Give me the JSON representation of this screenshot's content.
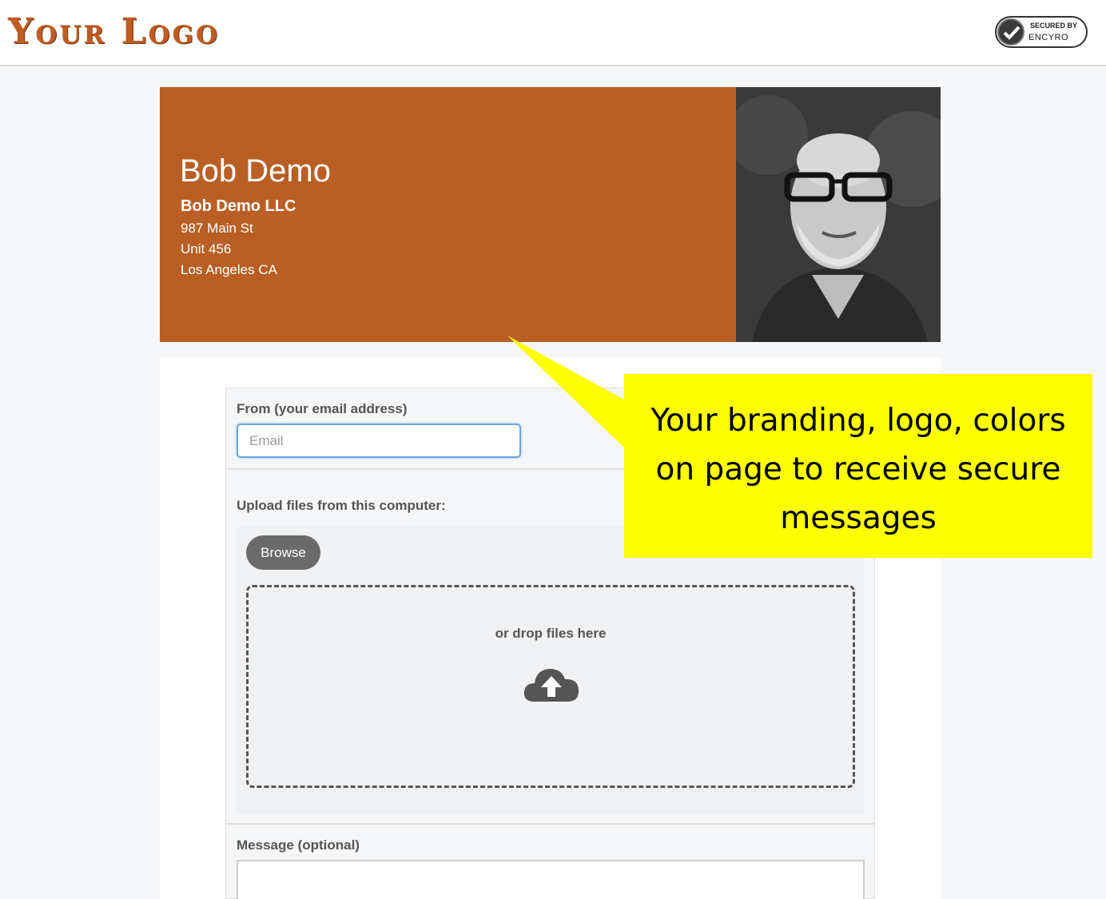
{
  "header": {
    "logo_text": "Your Logo",
    "badge_top": "SECURED BY",
    "badge_bottom": "ENCYRO"
  },
  "profile": {
    "name": "Bob Demo",
    "company": "Bob Demo LLC",
    "address_lines": [
      "987 Main St",
      "Unit 456",
      "Los Angeles CA"
    ],
    "brand_color": "#b95f25"
  },
  "form": {
    "from_label": "From (your email address)",
    "email_placeholder": "Email",
    "upload_label": "Upload files from this computer:",
    "browse_label": "Browse",
    "drop_text": "or drop files here",
    "message_label": "Message (optional)"
  },
  "callout": {
    "text_lines": [
      "Your branding, logo, colors",
      "on page to receive secure",
      "messages"
    ],
    "color": "#ffff00"
  }
}
